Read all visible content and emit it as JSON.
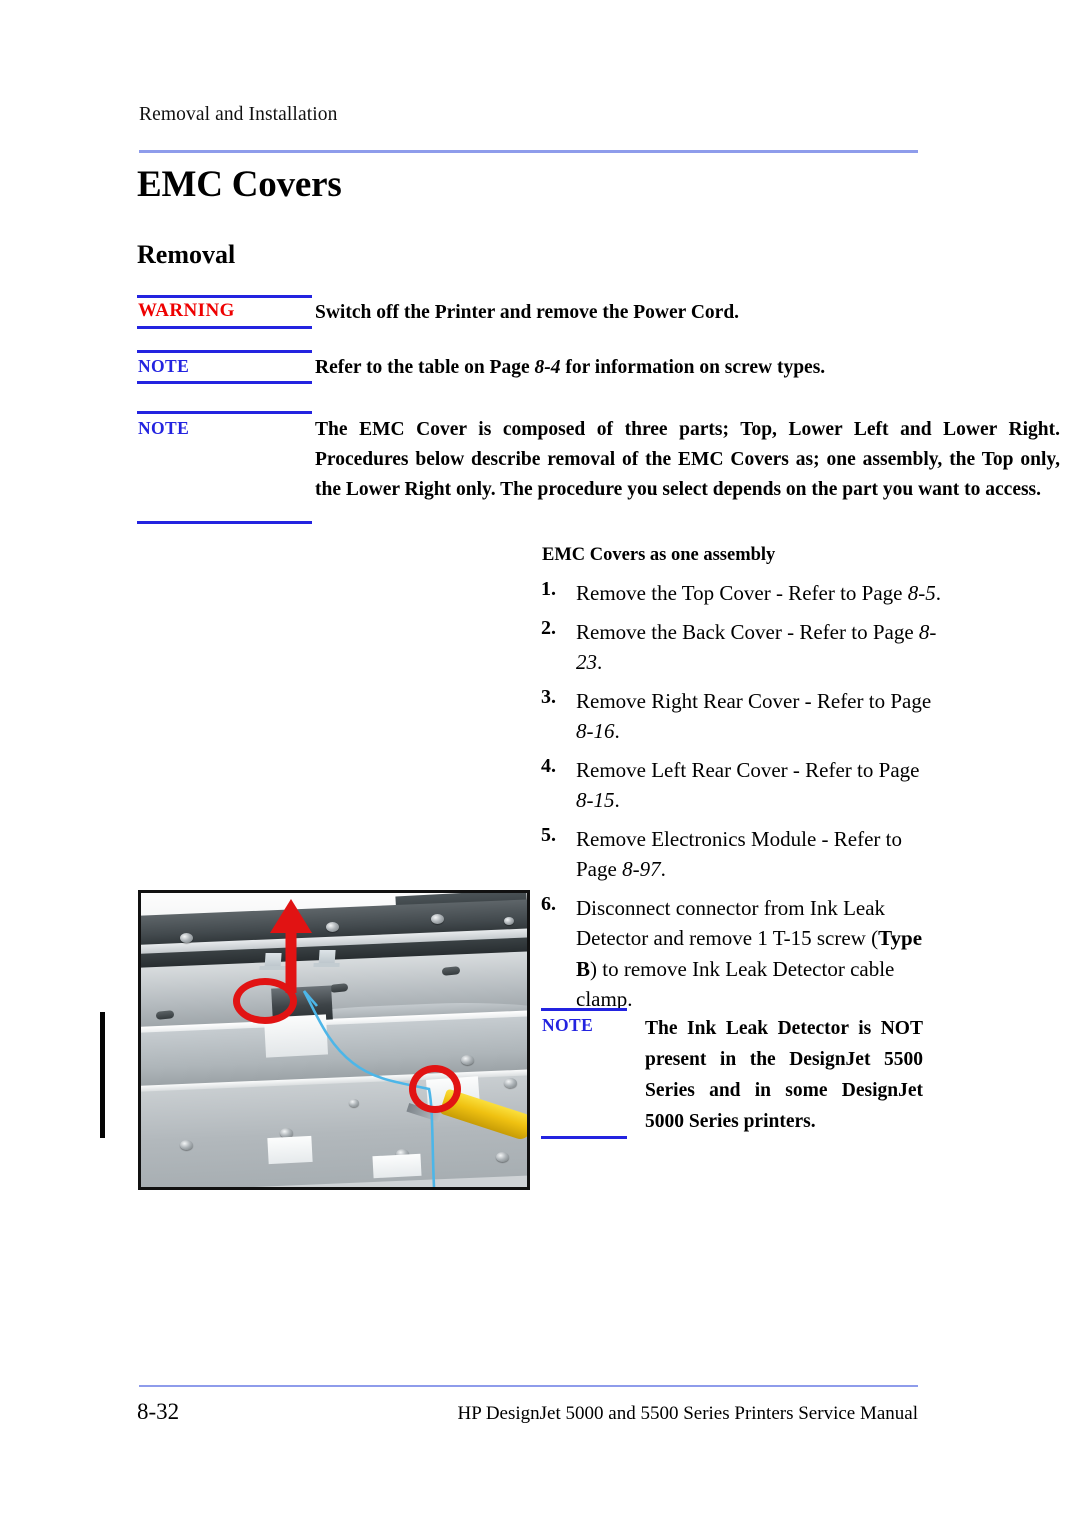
{
  "document": {
    "running_header": "Removal and Installation",
    "chapter_title": "EMC Covers",
    "section_title": "Removal"
  },
  "admonitions": {
    "warning": {
      "label": "WARNING",
      "text": "Switch off the Printer and remove the Power Cord."
    },
    "note_screw_types": {
      "label": "NOTE",
      "text_before": "Refer to the table on Page ",
      "page_ref": "8-4",
      "text_after": " for information on screw types."
    },
    "note_emc_cover": {
      "label": "NOTE",
      "text": "The EMC Cover is composed of three parts; Top, Lower Left and Lower Right. Procedures below describe removal of the EMC Covers as; one assembly, the Top only, the Lower Right only. The procedure you select depends on the part you want to access."
    },
    "note_ink_leak": {
      "label": "NOTE",
      "text": "The Ink Leak Detector is NOT present in the DesignJet 5500 Series and in some DesignJet 5000 Series printers."
    }
  },
  "procedure": {
    "sub_heading": "EMC Covers as one assembly",
    "steps": [
      {
        "num": "1.",
        "text_a": "Remove the Top Cover - Refer to Page ",
        "ref": "8-5",
        "text_b": "."
      },
      {
        "num": "2.",
        "text_a": "Remove the Back Cover - Refer to Page ",
        "ref": "8-23",
        "text_b": "."
      },
      {
        "num": "3.",
        "text_a": "Remove Right Rear Cover - Refer to Page ",
        "ref": "8-16",
        "text_b": "."
      },
      {
        "num": "4.",
        "text_a": "Remove Left Rear Cover - Refer to Page ",
        "ref": "8-15",
        "text_b": "."
      },
      {
        "num": "5.",
        "text_a": "Remove Electronics Module - Refer to Page ",
        "ref": "8-97",
        "text_b": "."
      },
      {
        "num": "6.",
        "text_a": "Disconnect connector from Ink Leak Detector and remove 1 T-15 screw (",
        "ref": "Type B",
        "text_b": ") to remove Ink Leak Detector cable clamp."
      }
    ]
  },
  "figure": {
    "caption": "",
    "alt": "Photograph of printer chassis showing Ink Leak Detector and cable clamp with red annotation circles and an upward arrow"
  },
  "footer": {
    "page_number": "8-32",
    "manual_title": "HP DesignJet 5000 and 5500 Series Printers Service Manual"
  },
  "colors": {
    "header_rule": "#8e9ceb",
    "warning": "#ee0000",
    "note": "#2323e0",
    "annotation_red": "#e11313"
  }
}
